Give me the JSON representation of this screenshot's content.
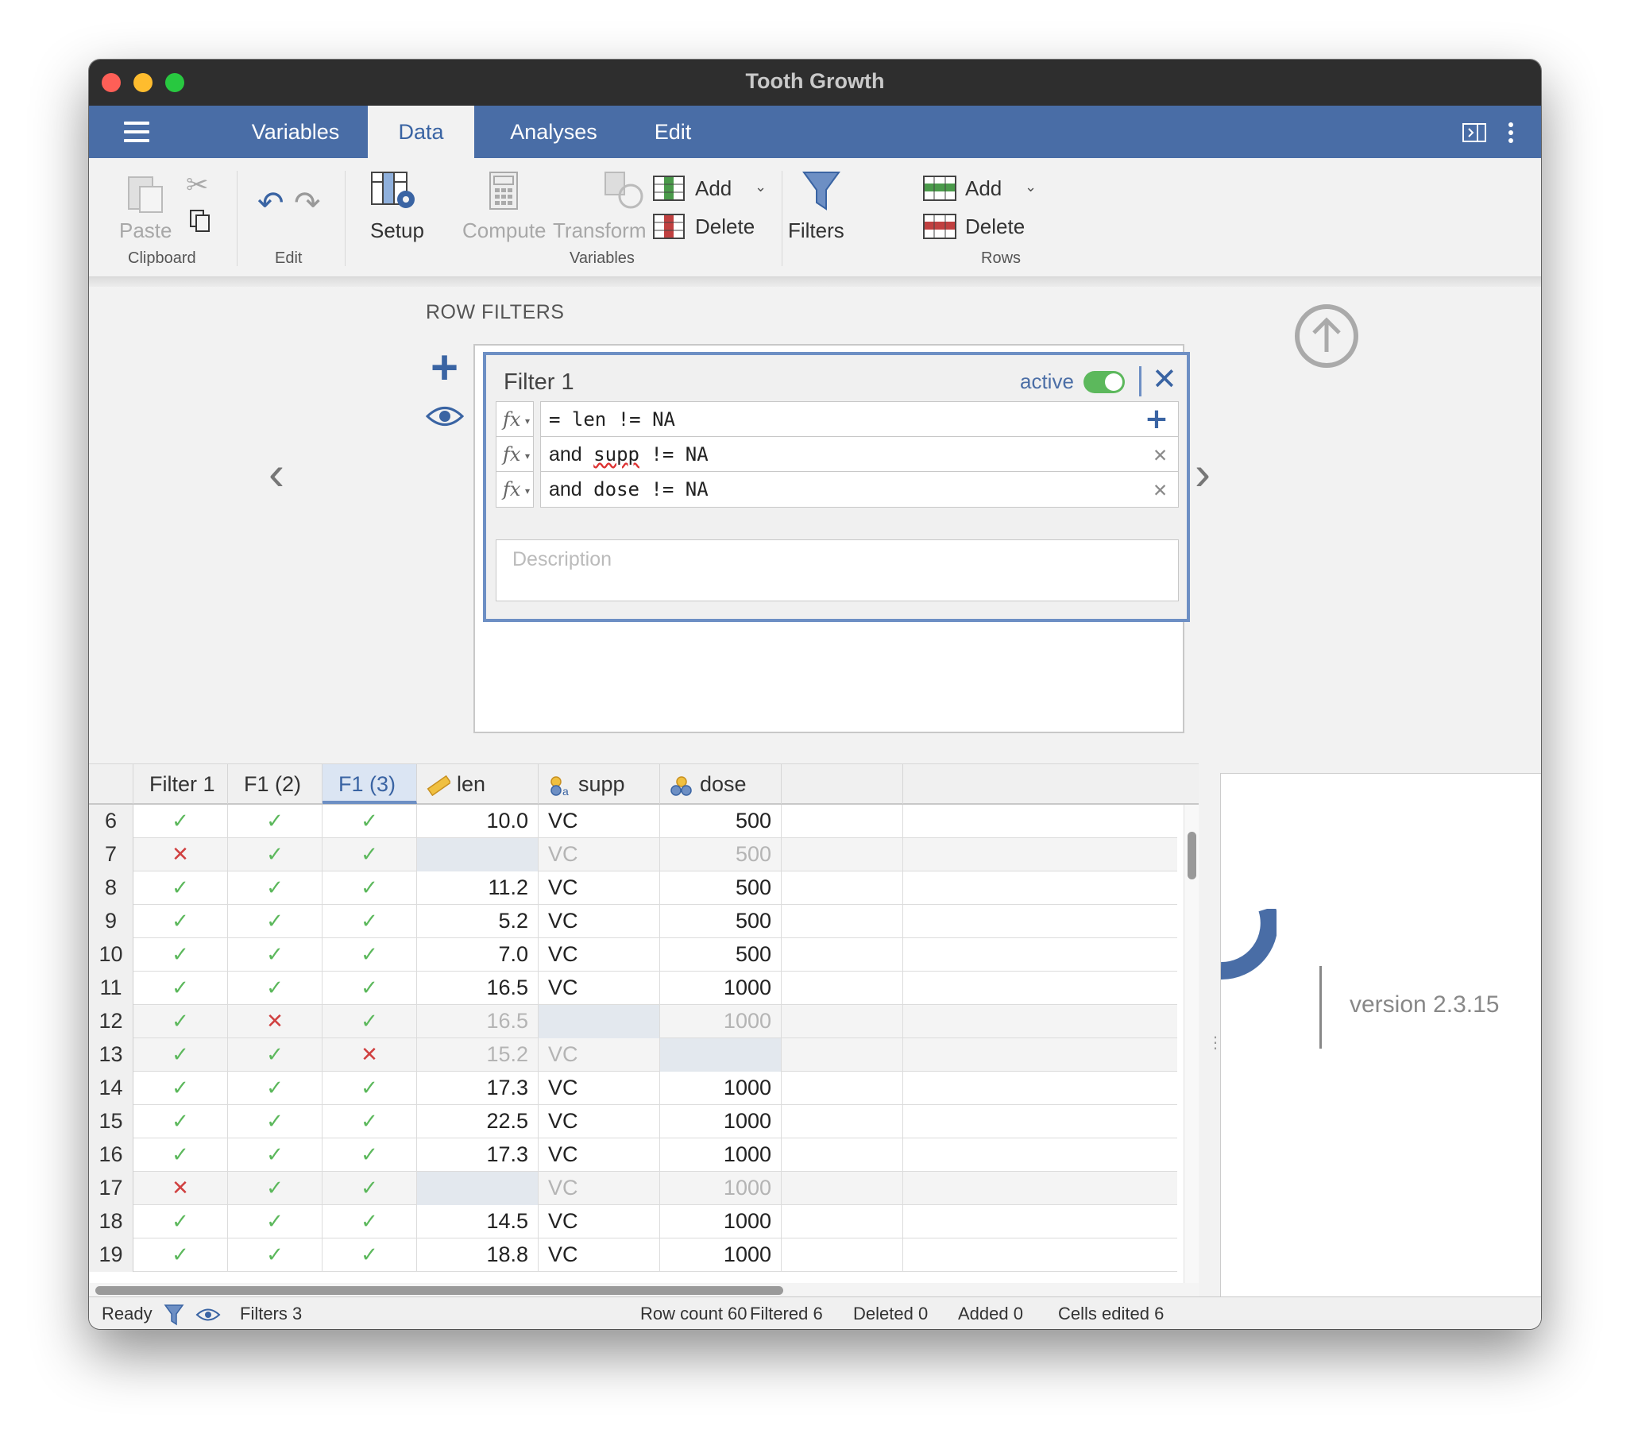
{
  "window": {
    "title": "Tooth Growth"
  },
  "tabs": [
    {
      "label": "Variables"
    },
    {
      "label": "Data",
      "active": true
    },
    {
      "label": "Analyses"
    },
    {
      "label": "Edit"
    }
  ],
  "ribbon": {
    "paste": "Paste",
    "clipboard_group": "Clipboard",
    "edit_group": "Edit",
    "setup": "Setup",
    "compute": "Compute",
    "transform": "Transform",
    "variables_group": "Variables",
    "var_add": "Add",
    "var_delete": "Delete",
    "filters": "Filters",
    "row_add": "Add",
    "row_delete": "Delete",
    "rows_group": "Rows"
  },
  "filter_panel": {
    "heading": "ROW FILTERS",
    "filter_name": "Filter 1",
    "active_label": "active",
    "active": true,
    "expressions": [
      {
        "prefix": "=",
        "var": "len",
        "op": "!= NA"
      },
      {
        "prefix": "and",
        "var": "supp",
        "op": "!= NA"
      },
      {
        "prefix": "and",
        "var": "dose",
        "op": "!= NA"
      }
    ],
    "description_placeholder": "Description"
  },
  "grid": {
    "columns": [
      "Filter 1",
      "F1 (2)",
      "F1 (3)",
      "len",
      "supp",
      "dose"
    ],
    "rows": [
      {
        "n": "6",
        "f1": "ok",
        "f2": "ok",
        "f3": "ok",
        "len": "10.0",
        "supp": "VC",
        "dose": "500"
      },
      {
        "n": "7",
        "f1": "no",
        "f2": "ok",
        "f3": "ok",
        "len": "",
        "supp": "VC",
        "dose": "500",
        "excluded": true,
        "missing": "len"
      },
      {
        "n": "8",
        "f1": "ok",
        "f2": "ok",
        "f3": "ok",
        "len": "11.2",
        "supp": "VC",
        "dose": "500"
      },
      {
        "n": "9",
        "f1": "ok",
        "f2": "ok",
        "f3": "ok",
        "len": "5.2",
        "supp": "VC",
        "dose": "500"
      },
      {
        "n": "10",
        "f1": "ok",
        "f2": "ok",
        "f3": "ok",
        "len": "7.0",
        "supp": "VC",
        "dose": "500"
      },
      {
        "n": "11",
        "f1": "ok",
        "f2": "ok",
        "f3": "ok",
        "len": "16.5",
        "supp": "VC",
        "dose": "1000"
      },
      {
        "n": "12",
        "f1": "ok",
        "f2": "no",
        "f3": "ok",
        "len": "16.5",
        "supp": "",
        "dose": "1000",
        "excluded": true,
        "missing": "supp"
      },
      {
        "n": "13",
        "f1": "ok",
        "f2": "ok",
        "f3": "no",
        "len": "15.2",
        "supp": "VC",
        "dose": "",
        "excluded": true,
        "missing": "dose"
      },
      {
        "n": "14",
        "f1": "ok",
        "f2": "ok",
        "f3": "ok",
        "len": "17.3",
        "supp": "VC",
        "dose": "1000"
      },
      {
        "n": "15",
        "f1": "ok",
        "f2": "ok",
        "f3": "ok",
        "len": "22.5",
        "supp": "VC",
        "dose": "1000"
      },
      {
        "n": "16",
        "f1": "ok",
        "f2": "ok",
        "f3": "ok",
        "len": "17.3",
        "supp": "VC",
        "dose": "1000"
      },
      {
        "n": "17",
        "f1": "no",
        "f2": "ok",
        "f3": "ok",
        "len": "",
        "supp": "VC",
        "dose": "1000",
        "excluded": true,
        "missing": "len"
      },
      {
        "n": "18",
        "f1": "ok",
        "f2": "ok",
        "f3": "ok",
        "len": "14.5",
        "supp": "VC",
        "dose": "1000"
      },
      {
        "n": "19",
        "f1": "ok",
        "f2": "ok",
        "f3": "ok",
        "len": "18.8",
        "supp": "VC",
        "dose": "1000"
      }
    ]
  },
  "results": {
    "version": "version 2.3.15"
  },
  "status": {
    "ready": "Ready",
    "filters": "Filters 3",
    "row_count": "Row count 60",
    "filtered": "Filtered 6",
    "deleted": "Deleted 0",
    "added": "Added 0",
    "cells_edited": "Cells edited 6"
  },
  "colors": {
    "accent": "#496da6",
    "check": "#5cb85c",
    "cross": "#d04040"
  }
}
